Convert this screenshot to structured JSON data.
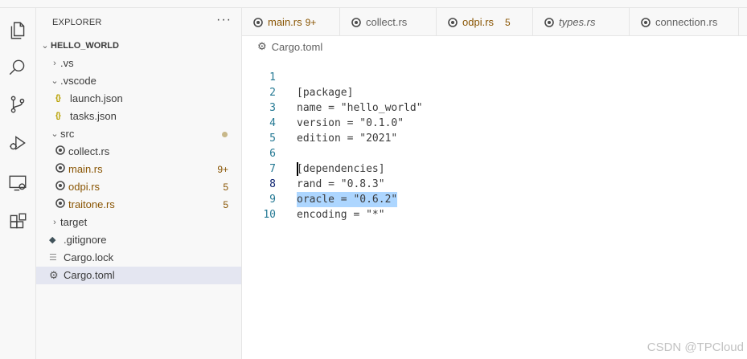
{
  "explorer": {
    "title": "EXPLORER",
    "more": "···",
    "root": "HELLO_WORLD",
    "items": [
      {
        "label": ".vs",
        "kind": "folder",
        "expanded": false
      },
      {
        "label": ".vscode",
        "kind": "folder",
        "expanded": true
      },
      {
        "label": "launch.json",
        "kind": "json"
      },
      {
        "label": "tasks.json",
        "kind": "json"
      },
      {
        "label": "src",
        "kind": "folder",
        "expanded": true
      },
      {
        "label": "collect.rs",
        "kind": "rs"
      },
      {
        "label": "main.rs",
        "kind": "rs",
        "badge": "9+"
      },
      {
        "label": "odpi.rs",
        "kind": "rs",
        "badge": "5"
      },
      {
        "label": "traitone.rs",
        "kind": "rs",
        "badge": "5"
      },
      {
        "label": "target",
        "kind": "folder",
        "expanded": false
      },
      {
        "label": ".gitignore",
        "kind": "git"
      },
      {
        "label": "Cargo.lock",
        "kind": "lock"
      },
      {
        "label": "Cargo.toml",
        "kind": "toml",
        "selected": true
      }
    ]
  },
  "tabs": [
    {
      "label": "main.rs",
      "badge": "9+"
    },
    {
      "label": "collect.rs"
    },
    {
      "label": "odpi.rs",
      "badge": "5"
    },
    {
      "label": "types.rs"
    },
    {
      "label": "connection.rs"
    }
  ],
  "breadcrumb": "Cargo.toml",
  "editor": {
    "active_line": 8,
    "lines": [
      {
        "n": "1",
        "text": "[package]"
      },
      {
        "n": "2",
        "text": "name = \"hello_world\""
      },
      {
        "n": "3",
        "text": "version = \"0.1.0\""
      },
      {
        "n": "4",
        "text": "edition = \"2021\""
      },
      {
        "n": "5",
        "text": ""
      },
      {
        "n": "6",
        "text": "[dependencies]"
      },
      {
        "n": "7",
        "text": "rand = \"0.8.3\""
      },
      {
        "n": "8",
        "text": "oracle = \"0.6.2\""
      },
      {
        "n": "9",
        "text": "encoding = \"*\""
      },
      {
        "n": "10",
        "text": ""
      }
    ]
  },
  "watermark": "CSDN @TPCloud",
  "colors": {
    "warning": "#895503",
    "selection": "#add6ff",
    "line_number": "#237893"
  }
}
